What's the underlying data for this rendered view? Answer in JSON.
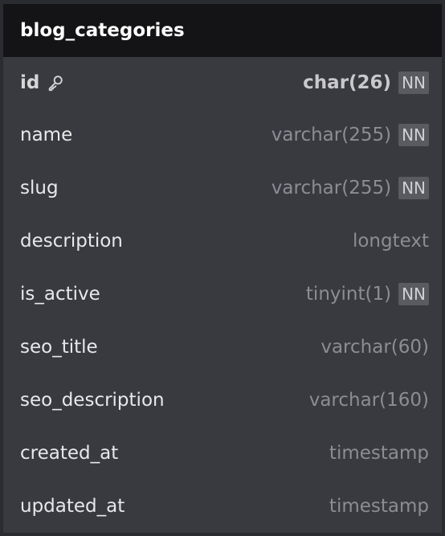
{
  "table": {
    "name": "blog_categories",
    "columns": [
      {
        "name": "id",
        "type": "char(26)",
        "badge": "NN",
        "primary_key": true,
        "icon": "key-icon"
      },
      {
        "name": "name",
        "type": "varchar(255)",
        "badge": "NN"
      },
      {
        "name": "slug",
        "type": "varchar(255)",
        "badge": "NN"
      },
      {
        "name": "description",
        "type": "longtext",
        "badge": ""
      },
      {
        "name": "is_active",
        "type": "tinyint(1)",
        "badge": "NN"
      },
      {
        "name": "seo_title",
        "type": "varchar(60)",
        "badge": ""
      },
      {
        "name": "seo_description",
        "type": "varchar(160)",
        "badge": ""
      },
      {
        "name": "created_at",
        "type": "timestamp",
        "badge": ""
      },
      {
        "name": "updated_at",
        "type": "timestamp",
        "badge": ""
      }
    ]
  },
  "colors": {
    "background": "#2b2c31",
    "panel": "#393a40",
    "header": "#141416",
    "badge": "#5a5b61"
  }
}
